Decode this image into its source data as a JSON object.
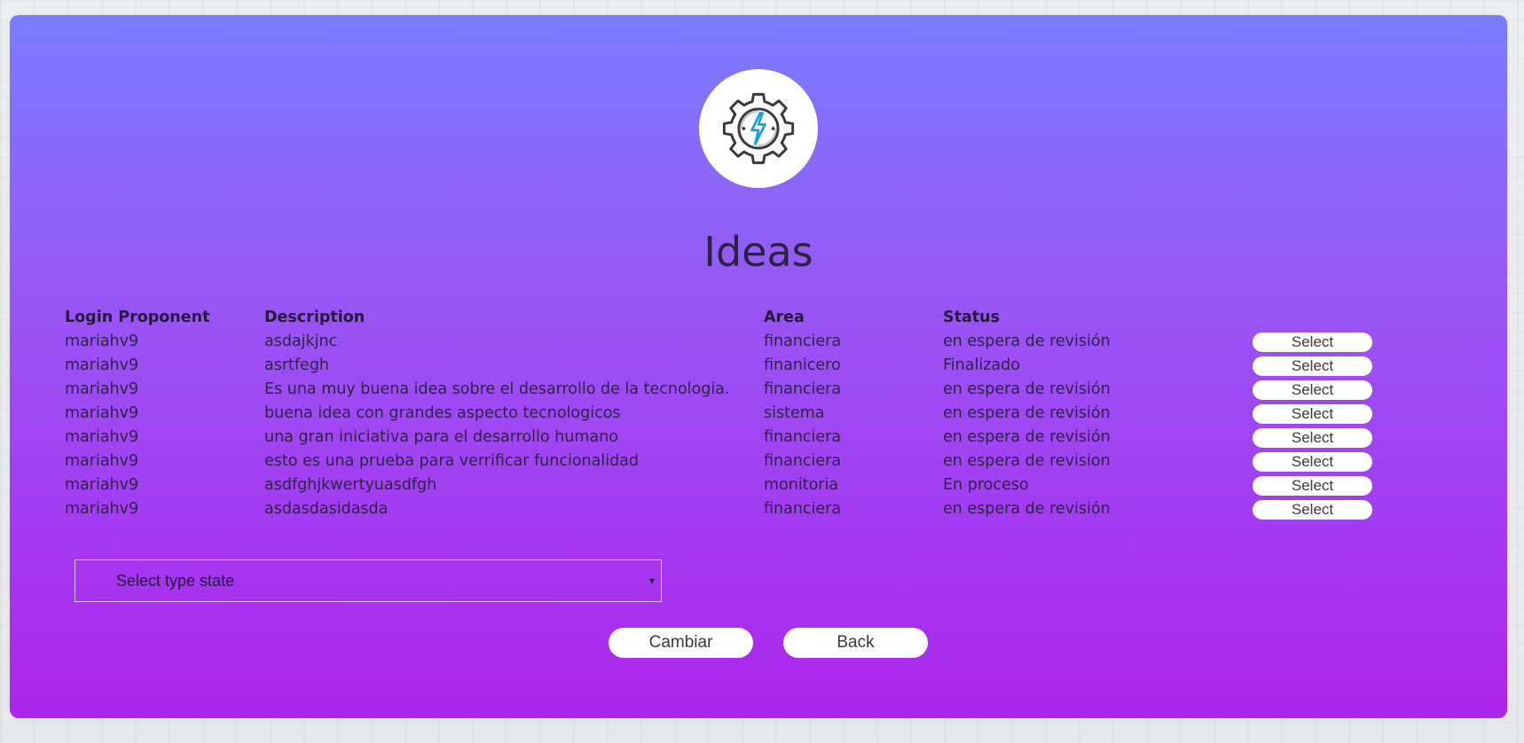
{
  "page": {
    "title": "Ideas"
  },
  "colors": {
    "gradient_top": "#7a7cfe",
    "gradient_bottom": "#ad24ed",
    "button_bg": "#ffffff",
    "logo_gear": "#3a3a3a",
    "logo_bolt": "#1aa0e0"
  },
  "logo": {
    "icon": "gear-lightning-icon"
  },
  "table": {
    "headers": {
      "login": "Login Proponent",
      "description": "Description",
      "area": "Area",
      "status": "Status"
    },
    "rows": [
      {
        "login": "mariahv9",
        "description": "asdajkjnc",
        "area": "financiera",
        "status": "en espera de revisión",
        "action": "Select"
      },
      {
        "login": "mariahv9",
        "description": "asrtfegh",
        "area": "finanicero",
        "status": "Finalizado",
        "action": "Select"
      },
      {
        "login": "mariahv9",
        "description": "Es una muy buena idea sobre el desarrollo de la tecnologia.",
        "area": "financiera",
        "status": "en espera de revisión",
        "action": "Select"
      },
      {
        "login": "mariahv9",
        "description": "buena idea con grandes aspecto tecnologicos",
        "area": "sistema",
        "status": "en espera de revisión",
        "action": "Select"
      },
      {
        "login": "mariahv9",
        "description": "una gran iniciativa para el desarrollo humano",
        "area": "financiera",
        "status": "en espera de revisión",
        "action": "Select"
      },
      {
        "login": "mariahv9",
        "description": "esto es una prueba para verrificar funcionalidad",
        "area": "financiera",
        "status": "en espera de revision",
        "action": "Select"
      },
      {
        "login": "mariahv9",
        "description": "asdfghjkwertyuasdfgh",
        "area": "monitoria",
        "status": "En proceso",
        "action": "Select"
      },
      {
        "login": "mariahv9",
        "description": "asdasdasidasda",
        "area": "financiera",
        "status": "en espera de revisión",
        "action": "Select"
      }
    ]
  },
  "state_select": {
    "selected": "Select type state",
    "arrow": "▾"
  },
  "buttons": {
    "change": "Cambiar",
    "back": "Back"
  }
}
